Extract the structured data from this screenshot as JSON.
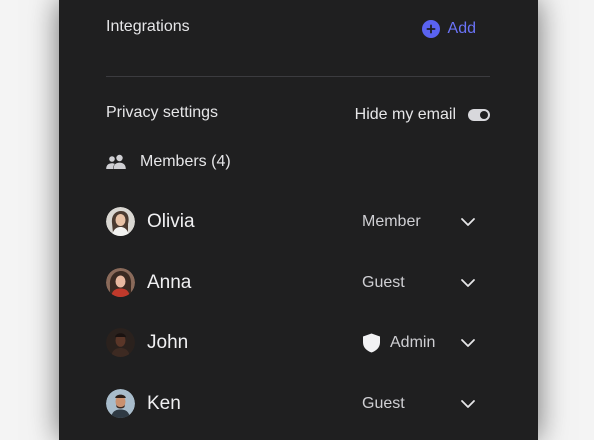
{
  "integrations": {
    "title": "Integrations",
    "add_label": "Add",
    "add_icon": "plus-circle-icon",
    "accent_color": "#6a73f7"
  },
  "privacy": {
    "title": "Privacy settings",
    "hide_email_label": "Hide my email",
    "hide_email_enabled": true
  },
  "members": {
    "icon": "people-icon",
    "label": "Members (4)",
    "list": [
      {
        "name": "Olivia",
        "role": "Member",
        "role_icon": null,
        "avatar_icon": "avatar-photo"
      },
      {
        "name": "Anna",
        "role": "Guest",
        "role_icon": null,
        "avatar_icon": "avatar-photo"
      },
      {
        "name": "John",
        "role": "Admin",
        "role_icon": "shield-icon",
        "avatar_icon": "avatar-photo"
      },
      {
        "name": "Ken",
        "role": "Guest",
        "role_icon": null,
        "avatar_icon": "avatar-photo"
      }
    ]
  },
  "colors": {
    "panel_bg": "#1f1f20",
    "text_primary": "#e6e6e8",
    "divider": "#3b3b3f"
  }
}
